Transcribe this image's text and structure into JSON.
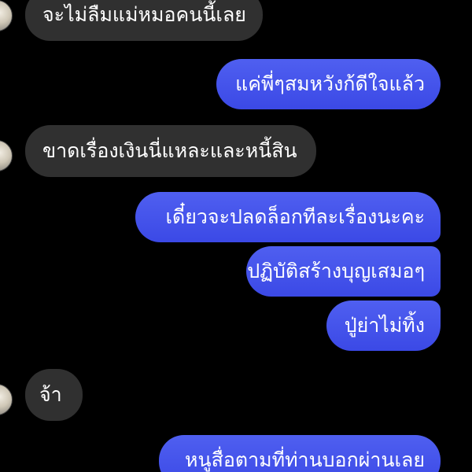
{
  "colors": {
    "background": "#000000",
    "incoming_bubble": "#303030",
    "outgoing_gradient": [
      "#4f5ff0",
      "#3b49e6"
    ]
  },
  "messages": [
    {
      "direction": "incoming",
      "text": "จะไม่ลืมแม่หมอคนนี้เลย",
      "avatar": "contact-avatar"
    },
    {
      "direction": "outgoing",
      "text": "แค่พี่ๆสมหวังก้ดีใจแล้ว"
    },
    {
      "direction": "incoming",
      "text": "ขาดเรื่องเงินนี่แหละและหนี้สิน",
      "avatar": "contact-avatar"
    },
    {
      "direction": "outgoing",
      "text": "เดี๋ยวจะปลดล็อกทีละเรื่องนะคะ"
    },
    {
      "direction": "outgoing",
      "text": "ปฏิบัติสร้างบุญเสมอๆ"
    },
    {
      "direction": "outgoing",
      "text": "ปู่ย่าไม่ทิ้ง"
    },
    {
      "direction": "incoming",
      "text": "จ้า",
      "avatar": "contact-avatar"
    },
    {
      "direction": "outgoing",
      "text": "หนูสื่อตามที่ท่านบอกผ่านเลย"
    }
  ]
}
